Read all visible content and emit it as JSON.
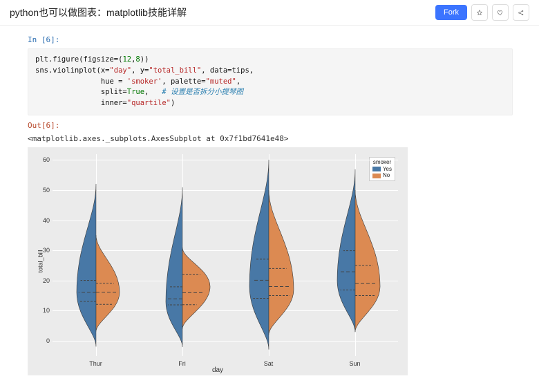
{
  "header": {
    "title": "python也可以做图表：matplotlib技能详解",
    "fork_label": "Fork"
  },
  "cell": {
    "in_prompt": "In [6]:",
    "out_prompt": "Out[6]:",
    "code": {
      "l1a": "plt.figure(figsize=(",
      "l1b": "12",
      "l1c": ",",
      "l1d": "8",
      "l1e": "))",
      "l2a": "sns.violinplot(x=",
      "l2b": "\"day\"",
      "l2c": ", y=",
      "l2d": "\"total_bill\"",
      "l2e": ", data=tips,",
      "l3a": "               hue = ",
      "l3b": "'smoker'",
      "l3c": ", palette=",
      "l3d": "\"muted\"",
      "l3e": ",",
      "l4a": "               split=",
      "l4b": "True",
      "l4c": ",   ",
      "l4d": "# 设置是否拆分小提琴图",
      "l5a": "               inner=",
      "l5b": "\"quartile\"",
      "l5c": ")"
    },
    "repr": "<matplotlib.axes._subplots.AxesSubplot at 0x7f1bd7641e48>"
  },
  "chart_data": {
    "type": "violin",
    "title": "",
    "xlabel": "day",
    "ylabel": "total_bill",
    "ylim": [
      -5,
      62
    ],
    "yticks": [
      0,
      10,
      20,
      30,
      40,
      50,
      60
    ],
    "categories": [
      "Thur",
      "Fri",
      "Sat",
      "Sun"
    ],
    "hue": "smoker",
    "hue_levels": [
      "Yes",
      "No"
    ],
    "colors": {
      "Yes": "#4878a6",
      "No": "#dc8a52"
    },
    "series": [
      {
        "day": "Thur",
        "smoker": "Yes",
        "q1": 13,
        "median": 16,
        "q3": 20,
        "min": -2,
        "max": 52,
        "peak": 16,
        "spread": 28
      },
      {
        "day": "Thur",
        "smoker": "No",
        "q1": 12,
        "median": 16,
        "q3": 19,
        "min": 3,
        "max": 35,
        "peak": 16,
        "spread": 34
      },
      {
        "day": "Fri",
        "smoker": "Yes",
        "q1": 12,
        "median": 14,
        "q3": 18,
        "min": -2,
        "max": 51,
        "peak": 13,
        "spread": 24
      },
      {
        "day": "Fri",
        "smoker": "No",
        "q1": 12,
        "median": 16,
        "q3": 22,
        "min": 4,
        "max": 31,
        "peak": 18,
        "spread": 40
      },
      {
        "day": "Sat",
        "smoker": "Yes",
        "q1": 14,
        "median": 20,
        "q3": 27,
        "min": -3,
        "max": 60,
        "peak": 18,
        "spread": 28
      },
      {
        "day": "Sat",
        "smoker": "No",
        "q1": 15,
        "median": 18,
        "q3": 24,
        "min": 2,
        "max": 50,
        "peak": 17,
        "spread": 36
      },
      {
        "day": "Sun",
        "smoker": "Yes",
        "q1": 17,
        "median": 23,
        "q3": 30,
        "min": 3,
        "max": 57,
        "peak": 20,
        "spread": 26
      },
      {
        "day": "Sun",
        "smoker": "No",
        "q1": 15,
        "median": 19,
        "q3": 25,
        "min": 3,
        "max": 50,
        "peak": 18,
        "spread": 36
      }
    ],
    "legend": {
      "title": "smoker",
      "items": [
        {
          "label": "Yes",
          "color": "#4878a6"
        },
        {
          "label": "No",
          "color": "#dc8a52"
        }
      ]
    }
  }
}
